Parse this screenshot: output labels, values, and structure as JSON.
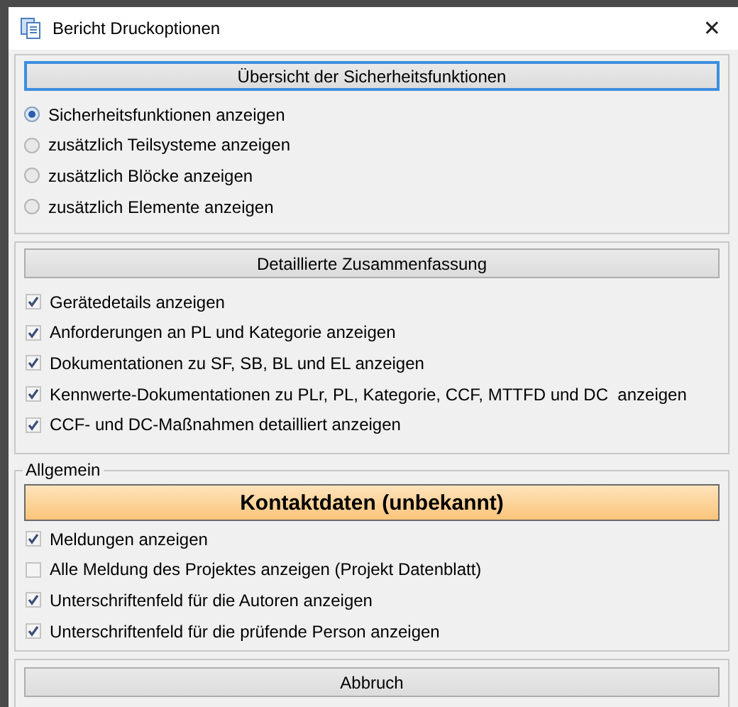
{
  "window": {
    "title": "Bericht Druckoptionen",
    "close": "✕"
  },
  "overview": {
    "header": "Übersicht der Sicherheitsfunktionen",
    "header_focused": true,
    "options": [
      {
        "label": "Sicherheitsfunktionen anzeigen",
        "selected": true
      },
      {
        "label": "zusätzlich Teilsysteme anzeigen",
        "selected": false
      },
      {
        "label": "zusätzlich Blöcke anzeigen",
        "selected": false
      },
      {
        "label": "zusätzlich Elemente anzeigen",
        "selected": false
      }
    ]
  },
  "summary": {
    "header": "Detaillierte Zusammenfassung",
    "options": [
      {
        "label": "Gerätedetails anzeigen",
        "checked": true
      },
      {
        "label": "Anforderungen an PL und Kategorie anzeigen",
        "checked": true
      },
      {
        "label": "Dokumentationen zu SF, SB, BL und EL anzeigen",
        "checked": true
      },
      {
        "label": "Kennwerte-Dokumentationen zu PLr, PL, Kategorie, CCF, MTTFD und DC  anzeigen",
        "checked": true
      },
      {
        "label": "CCF- und DC-Maßnahmen detailliert anzeigen",
        "checked": true
      }
    ]
  },
  "general": {
    "title": "Allgemein",
    "contact_button": "Kontaktdaten (unbekannt)",
    "options": [
      {
        "label": "Meldungen anzeigen",
        "checked": true
      },
      {
        "label": "Alle Meldung des Projektes anzeigen (Projekt Datenblatt)",
        "checked": false
      },
      {
        "label": "Unterschriftenfeld für die Autoren anzeigen",
        "checked": true
      },
      {
        "label": "Unterschriftenfeld für die prüfende Person anzeigen",
        "checked": true
      }
    ]
  },
  "cancel_button": "Abbruch"
}
